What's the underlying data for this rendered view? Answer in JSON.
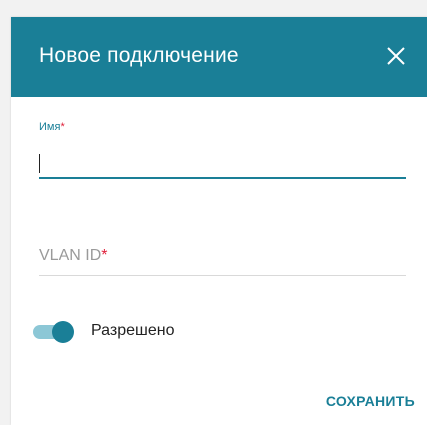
{
  "dialog": {
    "title": "Новое подключение",
    "close_icon": "close-icon"
  },
  "fields": {
    "name": {
      "label": "Имя",
      "required_mark": "*",
      "value": ""
    },
    "vlan_id": {
      "label": "VLAN ID",
      "required_mark": "*",
      "value": ""
    }
  },
  "toggle": {
    "label": "Разрешено",
    "state": "on"
  },
  "actions": {
    "save_label": "СОХРАНИТЬ"
  },
  "colors": {
    "accent": "#1a7f97",
    "required": "#e0203a",
    "toggle_track": "#8cc7d6"
  }
}
